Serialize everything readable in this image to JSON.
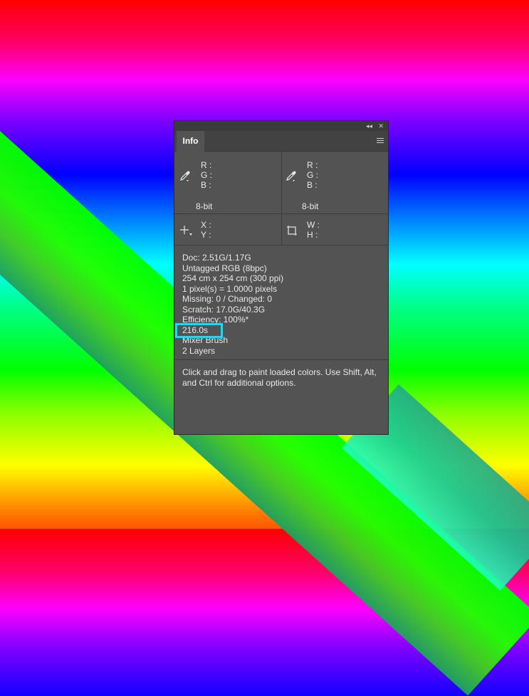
{
  "panel": {
    "tab_label": "Info",
    "collapse_glyph": "◂◂",
    "close_glyph": "✕",
    "readout_left": {
      "r": "R :",
      "g": "G :",
      "b": "B :",
      "mode": "8-bit"
    },
    "readout_right": {
      "r": "R :",
      "g": "G :",
      "b": "B :",
      "mode": "8-bit"
    },
    "coords": {
      "x": "X :",
      "y": "Y :"
    },
    "size": {
      "w": "W :",
      "h": "H :"
    },
    "stats": [
      "Doc: 2.51G/1.17G",
      "Untagged RGB (8bpc)",
      "254 cm x 254 cm (300 ppi)",
      "1 pixel(s) = 1.0000 pixels",
      "Missing: 0 / Changed: 0",
      "Scratch: 17.0G/40.3G",
      "Efficiency: 100%*",
      "216.0s",
      "Mixer Brush",
      "2 Layers"
    ],
    "help_text": "Click and drag to paint loaded colors.  Use Shift, Alt, and Ctrl for additional options.",
    "highlight_color": "#2ad4e8"
  },
  "icons": {
    "eyedropper": "eyedropper-icon",
    "crosshair": "crosshair-icon",
    "marquee": "marquee-icon",
    "menu": "panel-menu-icon"
  }
}
